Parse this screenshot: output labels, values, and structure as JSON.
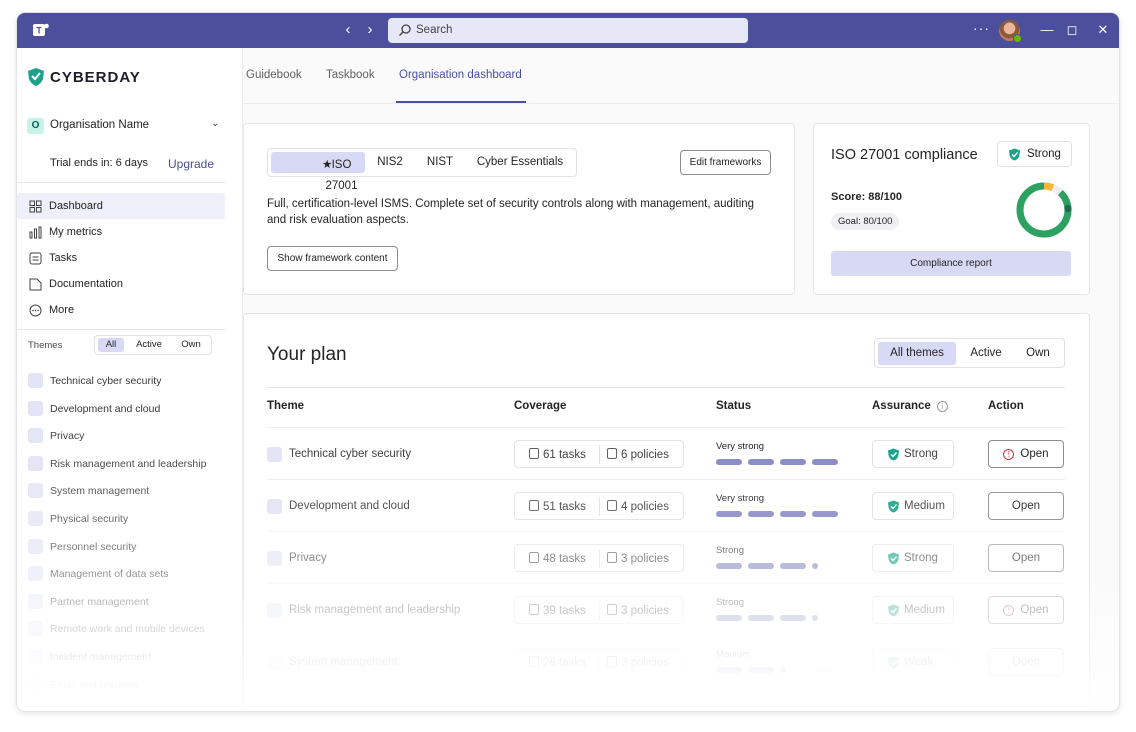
{
  "titlebar": {
    "search_placeholder": "Search",
    "more_label": "···"
  },
  "brand": {
    "name": "CYBERDAY"
  },
  "org": {
    "initial": "O",
    "name": "Organisation Name",
    "trial": "Trial ends in: 6 days",
    "upgrade": "Upgrade"
  },
  "nav": [
    {
      "label": "Dashboard",
      "icon": "grid-icon"
    },
    {
      "label": "My metrics",
      "icon": "bar-chart-icon"
    },
    {
      "label": "Tasks",
      "icon": "tasks-icon"
    },
    {
      "label": "Documentation",
      "icon": "document-icon"
    },
    {
      "label": "More",
      "icon": "more-icon"
    }
  ],
  "themes": {
    "header": "Themes",
    "filters": [
      "All",
      "Active",
      "Own"
    ],
    "items": [
      "Technical cyber security",
      "Development and cloud",
      "Privacy",
      "Risk management and leadership",
      "System management",
      "Physical security",
      "Personnel security",
      "Management of data sets",
      "Partner management",
      "Remote work and mobile devices",
      "Incident management",
      "Email and phishing"
    ]
  },
  "tabs": [
    "Guidebook",
    "Taskbook",
    "Organisation dashboard"
  ],
  "frameworks": {
    "items": [
      "ISO 27001",
      "NIS2",
      "NIST",
      "Cyber Essentials"
    ],
    "edit_label": "Edit frameworks",
    "description": "Full, certification-level ISMS. Complete set of security controls along with management, auditing and risk evaluation aspects.",
    "show_label": "Show framework content"
  },
  "compliance": {
    "title": "ISO 27001 compliance",
    "badge": "Strong",
    "score": "Score: 88/100",
    "goal": "Goal: 80/100",
    "score_value": 88,
    "goal_value": 80,
    "report_label": "Compliance report",
    "colors": {
      "ring": "#2da160",
      "goal_marker": "#f5b53d",
      "end_marker": "#1f6b4c"
    }
  },
  "plan": {
    "title": "Your plan",
    "filters": [
      "All themes",
      "Active",
      "Own"
    ],
    "columns": [
      "Theme",
      "Coverage",
      "Status",
      "Assurance",
      "Action"
    ],
    "rows": [
      {
        "theme": "Technical cyber security",
        "tasks": "61 tasks",
        "policies": "6 policies",
        "status": "Very strong",
        "level": 4,
        "assurance": "Strong",
        "action": "Open",
        "warning": true
      },
      {
        "theme": "Development and cloud",
        "tasks": "51 tasks",
        "policies": "4 policies",
        "status": "Very strong",
        "level": 4,
        "assurance": "Medium",
        "action": "Open",
        "warning": false
      },
      {
        "theme": "Privacy",
        "tasks": "48 tasks",
        "policies": "3 policies",
        "status": "Strong",
        "level": 3,
        "assurance": "Strong",
        "action": "Open",
        "warning": false
      },
      {
        "theme": "Risk management and leadership",
        "tasks": "39 tasks",
        "policies": "3 policies",
        "status": "Strong",
        "level": 3,
        "assurance": "Medium",
        "action": "Open",
        "warning": true
      },
      {
        "theme": "System management",
        "tasks": "28 tasks",
        "policies": "3 policies",
        "status": "Medium",
        "level": 2,
        "assurance": "Weak",
        "action": "Open",
        "warning": false
      }
    ]
  },
  "colors": {
    "accent": "#4b4f9c",
    "selected": "#d8d9f5",
    "shield": "#1aa38a"
  }
}
